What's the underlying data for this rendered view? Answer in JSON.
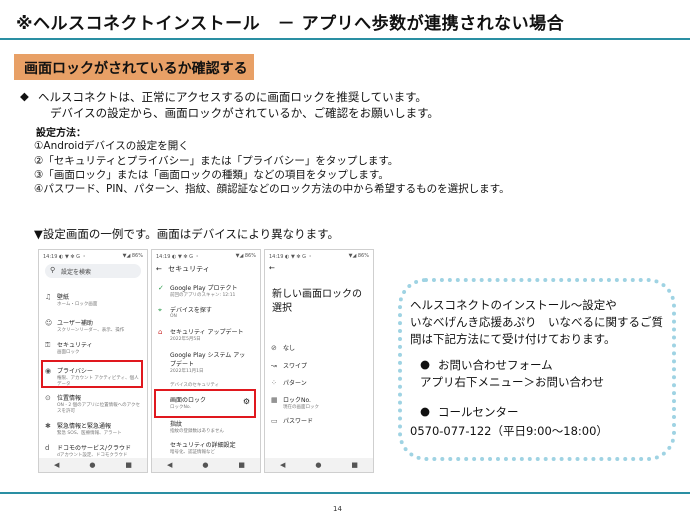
{
  "title": "※ヘルスコネクトインストール　－ アプリへ歩数が連携されない場合",
  "section": "画面ロックがされているか確認する",
  "bullet_symbol": "◆",
  "intro": [
    "ヘルスコネクトは、正常にアクセスするのに画面ロックを推奨しています。",
    "デバイスの設定から、画面ロックがされているか、ご確認をお願いします。"
  ],
  "how_label": "設定方法：",
  "steps": [
    "①Androidデバイスの設定を開く",
    "②「セキュリティとプライバシー」または「プライバシー」をタップします。",
    "③「画面ロック」または「画面ロックの種類」などの項目をタップします。",
    "④パスワード、PIN、パターン、指紋、顔認証などのロック方法の中から希望するものを選択します。"
  ],
  "example_note": "▼設定画面の一例です。画面はデバイスにより異なります。",
  "phone1": {
    "status_time": "14:19 ◐ ▼ ✻ G ・",
    "status_right": "▼◢ 86%",
    "search": "設定を検索",
    "items": [
      {
        "icon": "♫",
        "label": "壁紙",
        "sub": "ホーム・ロック画面"
      },
      {
        "icon": "☺",
        "label": "ユーザー補助",
        "sub": "スクリーンリーダー、表示、操作"
      },
      {
        "icon": "⚿",
        "label": "セキュリティ",
        "sub": "画面ロック"
      },
      {
        "icon": "◉",
        "label": "プライバシー",
        "sub": "権限、アカウント アクティビティ、個人データ"
      },
      {
        "icon": "⊙",
        "label": "位置情報",
        "sub": "ON - 2 個のアプリに位置情報へのアクセスを許可"
      },
      {
        "icon": "✱",
        "label": "緊急情報と緊急通報",
        "sub": "緊急 SOS、医療情報、アラート"
      },
      {
        "icon": "d",
        "label": "ドコモのサービス/クラウド",
        "sub": "dアカウント設定、ドコモクラウド"
      }
    ]
  },
  "phone2": {
    "status_time": "14:19 ◐ ▼ ✻ G ・",
    "status_right": "▼◢ 86%",
    "back": "←",
    "header": "セキュリティ",
    "items": [
      {
        "icon": "✓",
        "label": "Google Play プロテクト",
        "sub": "前回のアプリのスキャン: 12:11"
      },
      {
        "icon": "⌖",
        "label": "デバイスを探す",
        "sub": "ON"
      },
      {
        "icon": "⌂",
        "label": "セキュリティ アップデート",
        "sub": "2022年5月5日"
      },
      {
        "icon": "",
        "label": "Google Play システム アップデート",
        "sub": "2022年11月1日"
      },
      {
        "icon": "",
        "label": "デバイスのセキュリティ",
        "sub": ""
      },
      {
        "icon": "",
        "label": "画面のロック",
        "sub": "ロックNo."
      },
      {
        "icon": "",
        "label": "指紋",
        "sub": "指紋の登録数はありません"
      },
      {
        "icon": "",
        "label": "セキュリティの詳細設定",
        "sub": "暗号化、認証情報など"
      }
    ],
    "gear": "⚙"
  },
  "phone3": {
    "status_time": "14:19 ◐ ▼ ✻ G ・",
    "status_right": "▼◢ 86%",
    "back": "←",
    "heading": "新しい画面ロックの選択",
    "options": [
      {
        "icon": "⊘",
        "label": "なし",
        "sub": ""
      },
      {
        "icon": "↝",
        "label": "スワイプ",
        "sub": ""
      },
      {
        "icon": "⁘",
        "label": "パターン",
        "sub": ""
      },
      {
        "icon": "▦",
        "label": "ロックNo.",
        "sub": "現在の画面ロック"
      },
      {
        "icon": "▭",
        "label": "パスワード",
        "sub": ""
      }
    ]
  },
  "nav": {
    "back": "◀",
    "home": "●",
    "recent": "■"
  },
  "info": {
    "line1": "ヘルスコネクトのインストール～設定や",
    "line2": "いなべげんき応援あぷり　いなべるに関するご質",
    "line3": "問は下記方法にて受け付けております。",
    "contact_form": "お問い合わせフォーム",
    "contact_form_path": "アプリ右下メニュー＞お問い合わせ",
    "call_center": "コールセンター",
    "phone": "0570-077-122（平日9:00～18:00）"
  },
  "page_number": "14"
}
